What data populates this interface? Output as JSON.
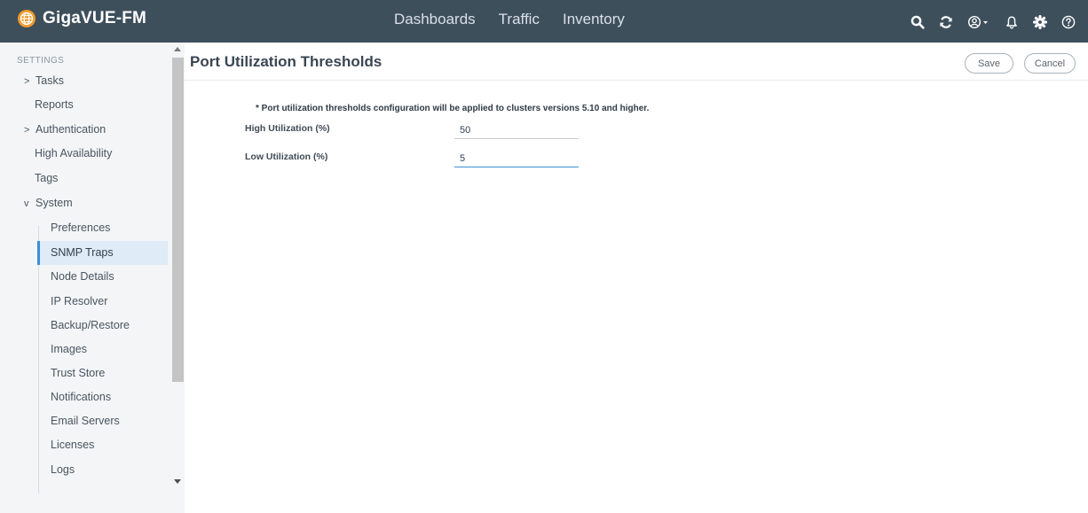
{
  "app": {
    "brand": "GigaVUE-FM"
  },
  "topnav": {
    "items": [
      "Dashboards",
      "Traffic",
      "Inventory"
    ]
  },
  "topicons": [
    "search-icon",
    "refresh-icon",
    "user-menu-icon",
    "bell-icon",
    "gear-icon",
    "help-icon"
  ],
  "sidebar": {
    "section_label": "SETTINGS",
    "items": [
      {
        "label": "Tasks",
        "caret": ">"
      },
      {
        "label": "Reports"
      },
      {
        "label": "Authentication",
        "caret": ">"
      },
      {
        "label": "High Availability"
      },
      {
        "label": "Tags"
      },
      {
        "label": "System",
        "caret": "v"
      }
    ],
    "sub_items": [
      {
        "label": "Preferences"
      },
      {
        "label": "SNMP Traps",
        "active": true
      },
      {
        "label": "Node Details"
      },
      {
        "label": "IP Resolver"
      },
      {
        "label": "Backup/Restore"
      },
      {
        "label": "Images"
      },
      {
        "label": "Trust Store"
      },
      {
        "label": "Notifications"
      },
      {
        "label": "Email Servers"
      },
      {
        "label": "Licenses"
      },
      {
        "label": "Logs"
      }
    ]
  },
  "page": {
    "title": "Port Utilization Thresholds",
    "save_label": "Save",
    "cancel_label": "Cancel",
    "notice": "* Port utilization thresholds configuration will be applied to clusters versions 5.10 and higher.",
    "fields": {
      "high": {
        "label": "High Utilization (%)",
        "value": "50"
      },
      "low": {
        "label": "Low Utilization (%)",
        "value": "5"
      }
    }
  },
  "colors": {
    "topbar": "#3e4f5c",
    "sidebar_bg": "#f3f5f7",
    "active_accent": "#3b8fd6",
    "active_bg": "#dfebf6"
  }
}
